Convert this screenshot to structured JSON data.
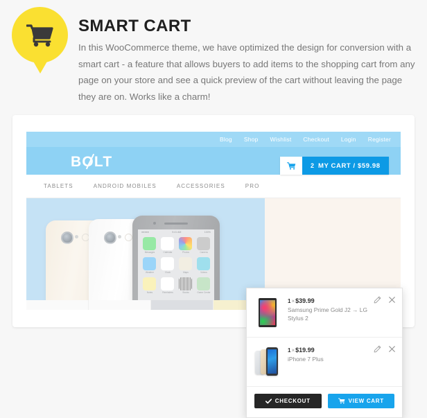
{
  "feature": {
    "icon": "shopping-cart-icon",
    "badge_color": "#fae031",
    "title": "SMART CART",
    "description": "In this WooCommerce  theme, we have optimized the design for conversion with a smart cart - a feature that allows buyers to add items to the shopping cart from any page on your store and see a quick preview of the cart without leaving the page they are on. Works like a charm!"
  },
  "mockup": {
    "topbar": {
      "links": [
        "Blog",
        "Shop",
        "Wishlist",
        "Checkout",
        "Login",
        "Register"
      ],
      "bg_color": "#9fd9f6"
    },
    "brand": {
      "name": "BOLT",
      "bg_color": "#8ed2f4"
    },
    "cart_button": {
      "icon": "cart-icon",
      "count": "2",
      "label": "MY CART / $59.98",
      "bg_color": "#0d9ae5"
    },
    "mainnav": {
      "items": [
        "TABLETS",
        "ANDROID MOBILES",
        "ACCESSORIES",
        "PRO"
      ]
    },
    "hero": {
      "bg_color": "#9ccdee",
      "phone_status_time": "9:41 AM",
      "phone_status_battery": "100%",
      "phone_apps": [
        {
          "name": "Messages",
          "color": "#4cd964"
        },
        {
          "name": "Calendar",
          "color": "#ffffff"
        },
        {
          "name": "Photos",
          "color": "#f2f2f2"
        },
        {
          "name": "Camera",
          "color": "#a8a8a8"
        },
        {
          "name": "Weather",
          "color": "#54b7f5"
        },
        {
          "name": "Clock",
          "color": "#ffffff"
        },
        {
          "name": "Maps",
          "color": "#e8e2cd"
        },
        {
          "name": "Videos",
          "color": "#5ac8e0"
        },
        {
          "name": "Notes",
          "color": "#f7e98a"
        },
        {
          "name": "Reminders",
          "color": "#ffffff"
        },
        {
          "name": "Stocks",
          "color": "#2b2b2b"
        },
        {
          "name": "Game Center",
          "color": "#9fd2a0"
        }
      ]
    }
  },
  "cart_panel": {
    "items": [
      {
        "thumb": "tablet-thumbnail",
        "quantity": "1",
        "multiplier": "×",
        "price": "$39.99",
        "name": "Samsung Prime Gold J2 → LG Stylus 2",
        "edit_icon": "pencil-icon",
        "remove_icon": "close-icon"
      },
      {
        "thumb": "phones-thumbnail",
        "quantity": "1",
        "multiplier": "×",
        "price": "$19.99",
        "name": "iPhone 7 Plus",
        "edit_icon": "pencil-icon",
        "remove_icon": "close-icon"
      }
    ],
    "actions": {
      "checkout_label": "CHECKOUT",
      "checkout_icon": "check-icon",
      "checkout_color": "#262626",
      "viewcart_label": "VIEW CART",
      "viewcart_icon": "cart-icon",
      "viewcart_color": "#18a4ec"
    }
  }
}
